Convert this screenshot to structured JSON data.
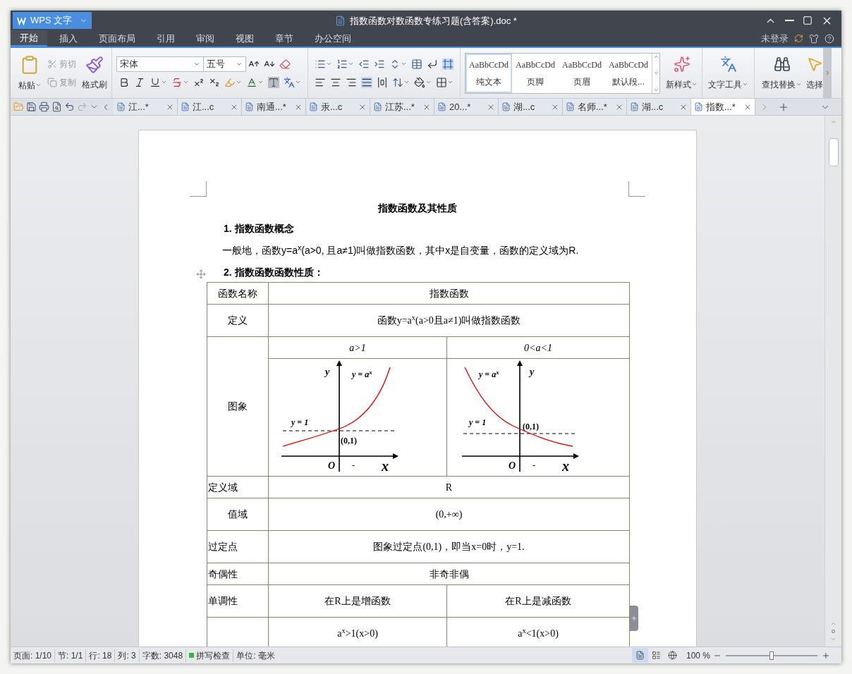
{
  "app": {
    "name": "WPS 文字"
  },
  "window": {
    "title": "指数函数对数函数专练习题(含答案).doc *"
  },
  "menu_tabs": [
    {
      "label": "开始",
      "selected": true
    },
    {
      "label": "插入",
      "selected": false
    },
    {
      "label": "页面布局",
      "selected": false
    },
    {
      "label": "引用",
      "selected": false
    },
    {
      "label": "审阅",
      "selected": false
    },
    {
      "label": "视图",
      "selected": false
    },
    {
      "label": "章节",
      "selected": false
    },
    {
      "label": "办公空间",
      "selected": false
    }
  ],
  "account": {
    "label": "未登录"
  },
  "ribbon": {
    "paste": "粘贴",
    "cut": {
      "label": "剪切",
      "disabled": true
    },
    "copy": {
      "label": "复制",
      "disabled": true
    },
    "format_painter": "格式刷",
    "font_name": "宋体",
    "font_size": "五号",
    "styles": [
      {
        "sample": "AaBbCcDd",
        "name": "纯文本",
        "selected": true
      },
      {
        "sample": "AaBbCcDd",
        "name": "页脚",
        "selected": false
      },
      {
        "sample": "AaBbCcDd",
        "name": "页眉",
        "selected": false
      },
      {
        "sample": "AaBbCcDd",
        "name": "默认段...",
        "selected": false
      }
    ],
    "new_style": "新样式",
    "text_tools": "文字工具",
    "find_replace": "查找替换",
    "select": "选择"
  },
  "doc_tabs": [
    {
      "label": "江...*",
      "selected": false
    },
    {
      "label": "江...c",
      "selected": false
    },
    {
      "label": "南通...*",
      "selected": false
    },
    {
      "label": "汞...c",
      "selected": false
    },
    {
      "label": "江苏...*",
      "selected": false
    },
    {
      "label": "20...*",
      "selected": false
    },
    {
      "label": "湖...c",
      "selected": false
    },
    {
      "label": "名师...*",
      "selected": false
    },
    {
      "label": "湖...c",
      "selected": false
    },
    {
      "label": "指数...*",
      "selected": true
    }
  ],
  "document": {
    "title": "指数函数及其性质",
    "heading_1": "1. 指数函数概念",
    "paragraph": "一般地，函数y=a$^{x}$(a>0, 且a≠1)叫做指数函数，其中x是自变量，函数的定义域为R.",
    "heading_2": "2. 指数函数函数性质：",
    "table": [
      {
        "kind": "text",
        "label": "函数名称",
        "cells": [
          "指数函数"
        ]
      },
      {
        "kind": "text",
        "label": "定义",
        "cells": [
          "函数y=a$^{x}$(a>0且a≠1)叫做指数函数"
        ]
      },
      {
        "kind": "graph",
        "label": "图象",
        "headers": [
          "a>1",
          "0<a<1"
        ],
        "graphs": [
          {
            "kind": "increasing",
            "y_axis": "y",
            "curve": "y = a$^{x}$",
            "line": "y = 1",
            "point": "(0,1)",
            "origin": "O",
            "tick": "-",
            "x_axis": "x"
          },
          {
            "kind": "decreasing",
            "y_axis": "y",
            "curve": "y = a$^{x}$",
            "line": "y = 1",
            "point": "(0,1)",
            "origin": "O",
            "tick": "-",
            "x_axis": "x"
          }
        ]
      },
      {
        "kind": "text",
        "label": "定义域",
        "cells": [
          "R"
        ]
      },
      {
        "kind": "text",
        "label": "值域",
        "cells": [
          "(0,+∞)"
        ]
      },
      {
        "kind": "text",
        "label": "过定点",
        "cells": [
          "图象过定点(0,1)，即当x=0时，y=1."
        ]
      },
      {
        "kind": "text",
        "label": "奇偶性",
        "cells": [
          "非奇非偶"
        ]
      },
      {
        "kind": "text",
        "label": "单调性",
        "cells": [
          "在R上是增函数",
          "在R上是减函数"
        ]
      },
      {
        "kind": "text",
        "cells": [
          "a$^{x}$>1(x>0)",
          "a$^{x}$<1(x>0)"
        ]
      }
    ]
  },
  "status_bar": {
    "items": [
      "页面: 1/10",
      "节: 1/1",
      "行: 18",
      "列: 3",
      "字数: 3048"
    ],
    "spell_check": "拼写检查",
    "unit": "单位: 毫米",
    "views": [
      {
        "kind": "page",
        "selected": true
      },
      {
        "kind": "outline",
        "selected": false
      },
      {
        "kind": "web",
        "selected": false
      }
    ],
    "zoom": "100 %",
    "zoom_slider": {
      "level": 0.5
    }
  }
}
